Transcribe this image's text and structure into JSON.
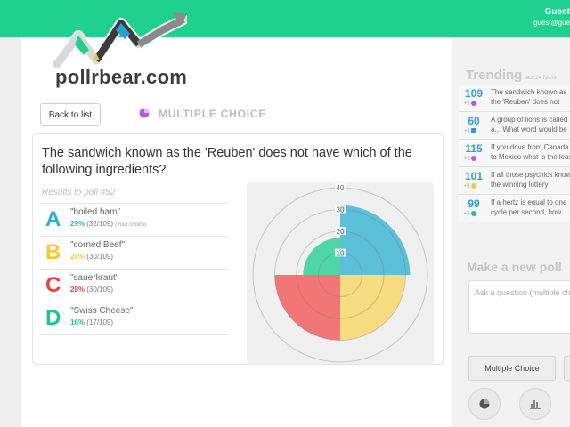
{
  "header": {
    "user_name": "Guest",
    "user_email": "guest@gue"
  },
  "brand": {
    "logo_text": "pollrbear.com",
    "accent": "#1fd08f"
  },
  "toolbar": {
    "back_label": "Back to list",
    "poll_type_label": "MULTIPLE CHOICE",
    "poll_type_icon": "pie-icon"
  },
  "poll": {
    "question": "The sandwich known as the 'Reuben' does not have which of the following ingredients?",
    "results_label": "Results to poll #52",
    "answers": [
      {
        "letter": "A",
        "text": "\"boiled ham\"",
        "pct": "29%",
        "counts": "(32/109)",
        "your_choice": "(Your choice)",
        "color": "#2eaed6"
      },
      {
        "letter": "B",
        "text": "\"corned Beef\"",
        "pct": "28%",
        "counts": "(30/109)",
        "your_choice": "",
        "color": "#f7c83e"
      },
      {
        "letter": "C",
        "text": "\"sauerkraut\"",
        "pct": "28%",
        "counts": "(30/109)",
        "your_choice": "",
        "color": "#ee4040"
      },
      {
        "letter": "D",
        "text": "\"Swiss Cheese\"",
        "pct": "16%",
        "counts": "(17/109)",
        "your_choice": "",
        "color": "#23c28e"
      }
    ]
  },
  "chart_data": {
    "type": "polar-area",
    "categories": [
      "\"boiled ham\"",
      "\"corned Beef\"",
      "\"sauerkraut\"",
      "\"Swiss Cheese\""
    ],
    "values": [
      32,
      30,
      30,
      17
    ],
    "colors": [
      "#5bc0d8",
      "#f7dd82",
      "#f27676",
      "#4fd5a8"
    ],
    "ticks": [
      "10",
      "20",
      "30",
      "40"
    ],
    "rmax": 40
  },
  "sidebar": {
    "trending_title": "Trending",
    "trending_subtitle": "last 24 hours",
    "trending": [
      {
        "count": "109",
        "delta": "+1",
        "icon": "pie-icon",
        "icon_color": "#b45bd8",
        "text": "The sandwich known as the 'Reuben' does not have which of the following"
      },
      {
        "count": "60",
        "delta": "+1",
        "icon": "bar-icon",
        "icon_color": "#2a9fd6",
        "text": "A group of lions is called a... What word would be used to describe"
      },
      {
        "count": "115",
        "delta": "+1",
        "icon": "pie-icon",
        "icon_color": "#b45bd8",
        "text": "If you drive from Canada to Mexico what is the least number of states"
      },
      {
        "count": "101",
        "delta": "+1",
        "icon": "bulb-icon",
        "icon_color": "#f7c83e",
        "text": "If all those psychics know the winning lottery numbers, why are they"
      },
      {
        "count": "99",
        "delta": "+1",
        "icon": "pie-icon",
        "icon_color": "#23c28e",
        "text": "If a hertz is equal to one cycle per second, how manyh cycles per second is equal?"
      }
    ],
    "new_poll_title": "Make a new poll",
    "new_poll_placeholder": "Ask a question (multiple choice)",
    "multiple_choice_label": "Multiple Choice"
  }
}
